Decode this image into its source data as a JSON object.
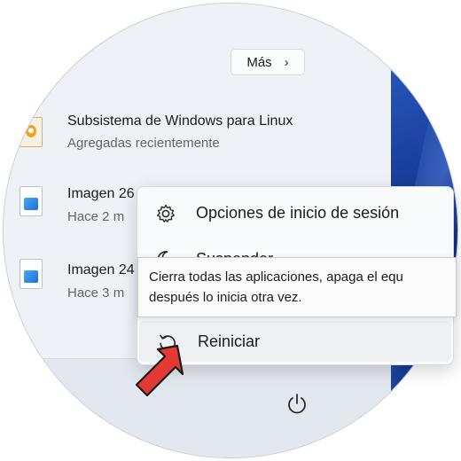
{
  "colors": {
    "accent": "#1e6fd8",
    "arrow": "#e02424",
    "wallpaper": "#1a3f9e"
  },
  "start_menu": {
    "more_button": {
      "label": "Más",
      "icon": "chevron-right-icon"
    },
    "recommended": [
      {
        "title": "Subsistema de Windows para Linux",
        "subtitle": "Agregadas recientemente",
        "icon": "linux-app-icon"
      },
      {
        "title": "Imagen 26",
        "subtitle": "Hace 2 m",
        "icon": "image-file-icon"
      },
      {
        "title": "Imagen 24",
        "subtitle": "Hace 3 m",
        "icon": "image-file-icon"
      }
    ]
  },
  "power_menu": {
    "items": [
      {
        "label": "Opciones de inicio de sesión",
        "icon": "gear-icon"
      },
      {
        "label": "Suspender",
        "icon": "moon-icon"
      },
      {
        "label": "Reiniciar",
        "icon": "restart-icon"
      }
    ],
    "tooltip_line1": "Cierra todas las aplicaciones, apaga el equ",
    "tooltip_line2": "después lo inicia otra vez."
  },
  "power_button": {
    "icon": "power-icon"
  },
  "annotation": {
    "icon": "red-arrow-icon"
  }
}
